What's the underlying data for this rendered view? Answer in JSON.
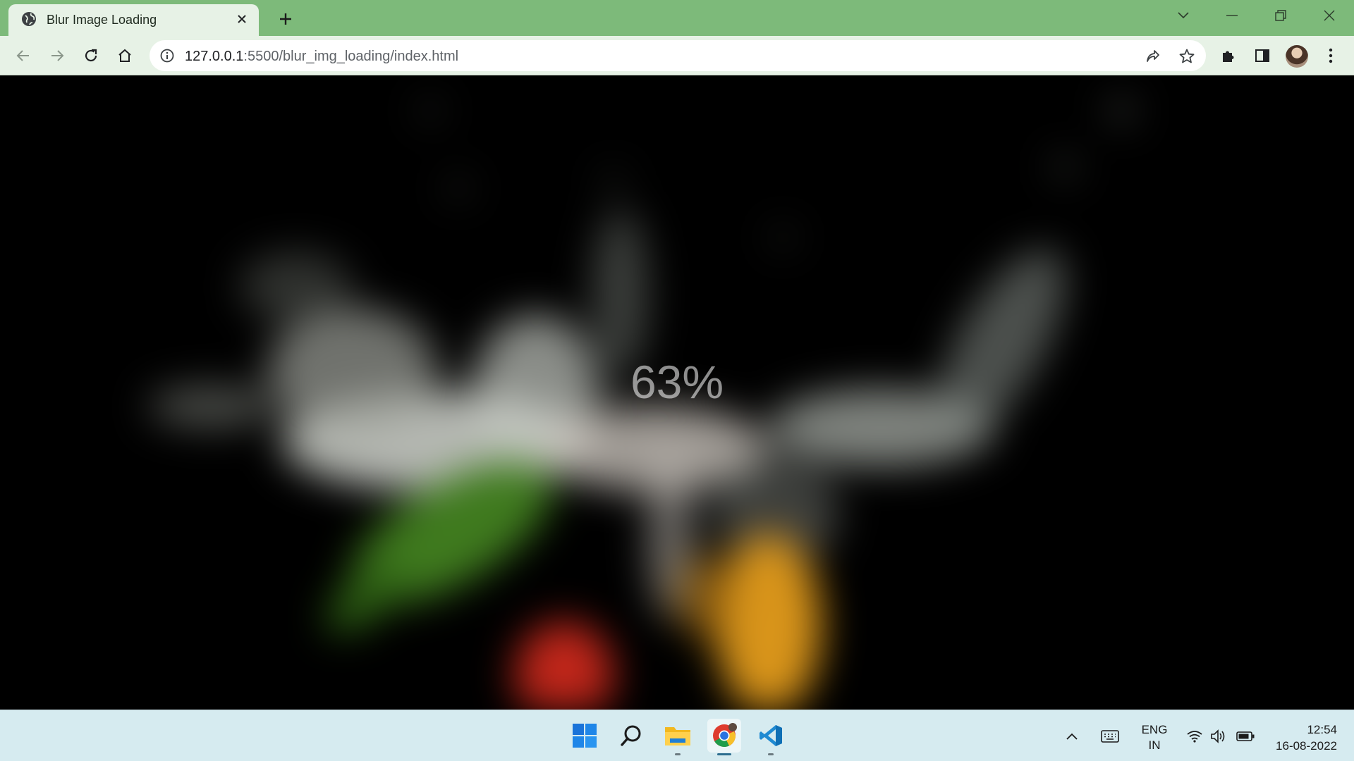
{
  "browser": {
    "tab": {
      "title": "Blur Image Loading"
    },
    "address": {
      "host": "127.0.0.1",
      "path": ":5500/blur_img_loading/index.html"
    }
  },
  "page": {
    "loading_percent_text": "63%",
    "loading_progress": 0.63,
    "background_description_colors": [
      "#000000",
      "#c8ccc6",
      "#3f7a1e",
      "#c0261a",
      "#d8941a"
    ]
  },
  "taskbar": {
    "pinned": [
      "windows-start",
      "search",
      "file-explorer",
      "chrome",
      "vscode"
    ],
    "tray": {
      "language_line1": "ENG",
      "language_line2": "IN",
      "time": "12:54",
      "date": "16-08-2022"
    }
  },
  "colors": {
    "tab_strip": "#7dba7a",
    "toolbar": "#e7f2e6",
    "taskbar": "#d6ebf0"
  }
}
